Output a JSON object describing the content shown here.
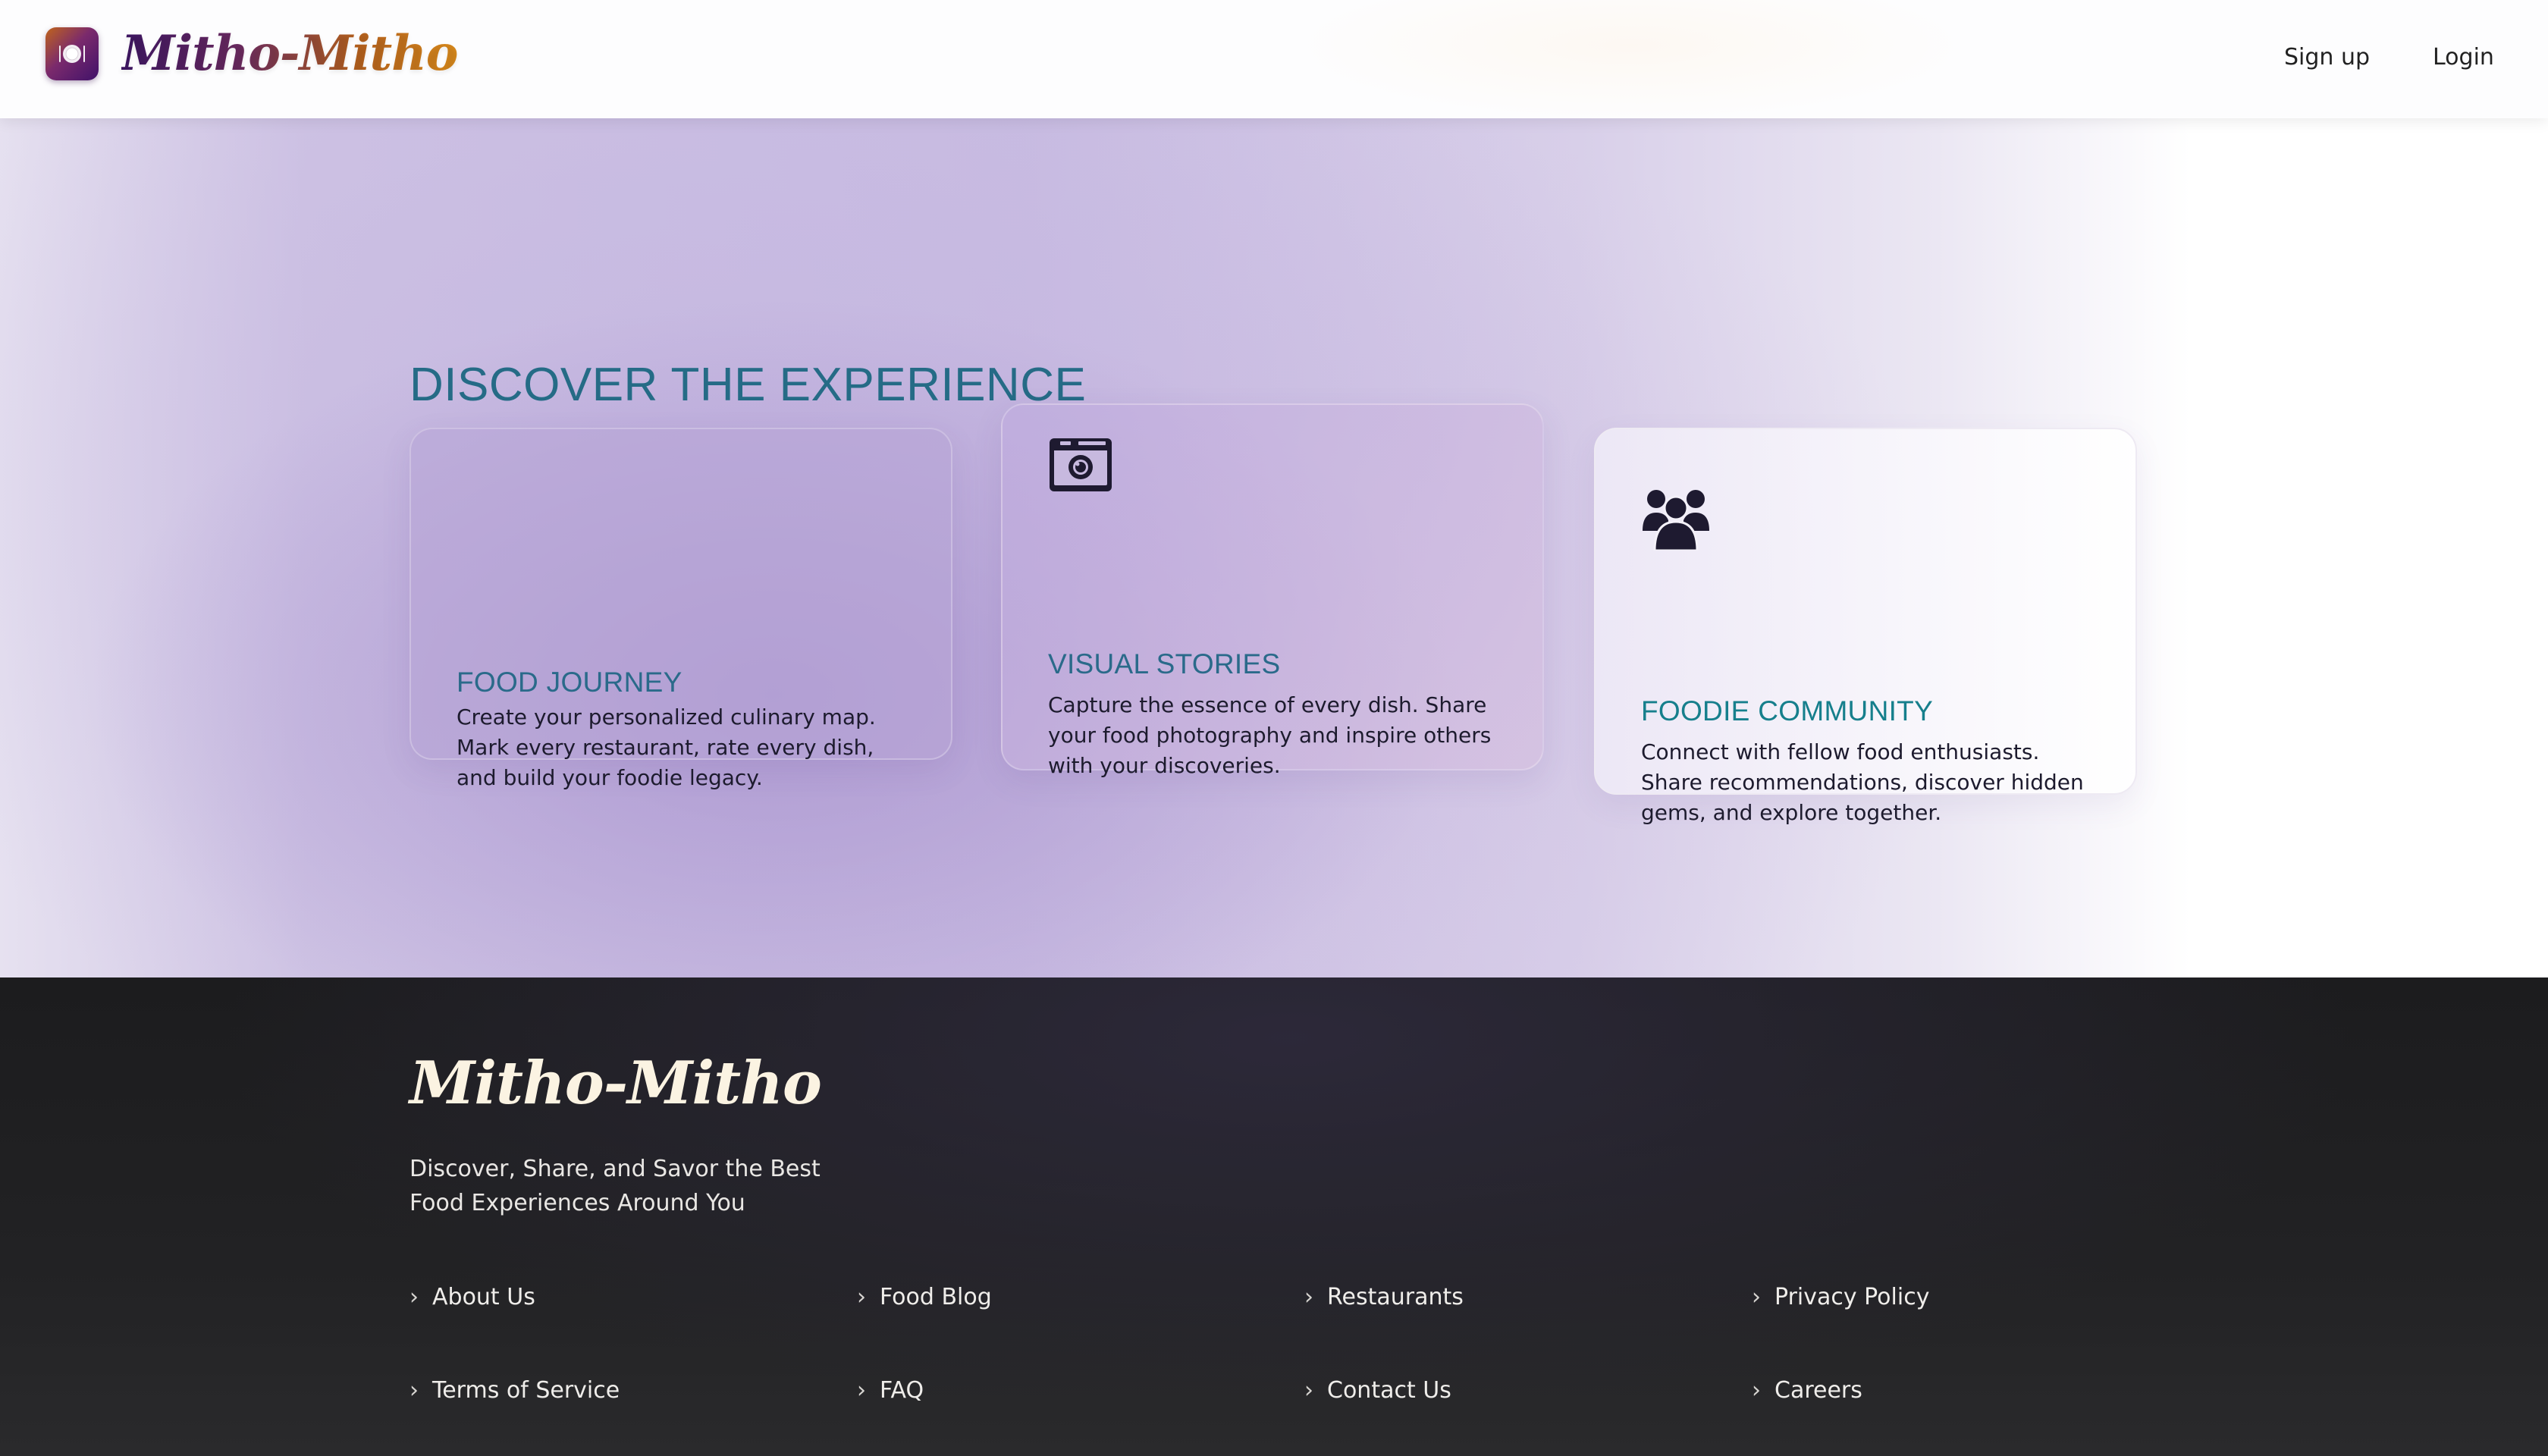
{
  "header": {
    "brand": "Mitho-Mitho",
    "logo_icon": "plate-cutlery-icon",
    "nav": {
      "signup": "Sign up",
      "login": "Login"
    }
  },
  "hero": {
    "title": "DISCOVER THE EXPERIENCE",
    "cards": [
      {
        "title": "FOOD JOURNEY",
        "text": "Create your personalized culinary map. Mark every restaurant, rate every dish, and build your foodie legacy."
      },
      {
        "icon": "camera-icon",
        "title": "VISUAL STORIES",
        "text": "Capture the essence of every dish. Share your food photography and inspire others with your discoveries."
      },
      {
        "icon": "users-icon",
        "title": "FOODIE COMMUNITY",
        "text": "Connect with fellow food enthusiasts. Share recommendations, discover hidden gems, and explore together."
      }
    ]
  },
  "footer": {
    "brand": "Mitho-Mitho",
    "tagline": "Discover, Share, and Savor the Best Food Experiences Around You",
    "chevron": "›",
    "links": [
      "About Us",
      "Food Blog",
      "Restaurants",
      "Privacy Policy",
      "Terms of Service",
      "FAQ",
      "Contact Us",
      "Careers"
    ]
  },
  "colors": {
    "heading_teal": "#256b86",
    "community_teal": "#167f8c",
    "footer_bg": "#1e1e20",
    "brand_purple": "#3d1663",
    "brand_orange": "#d98a1c"
  }
}
